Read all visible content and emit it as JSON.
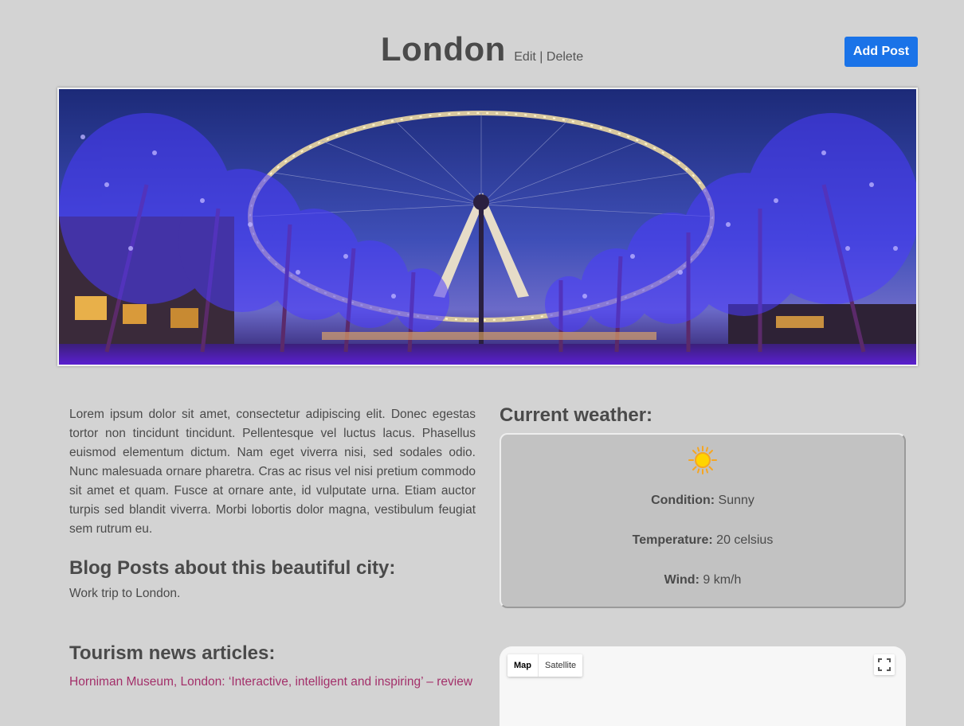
{
  "page": {
    "title": "London",
    "edit_label": "Edit",
    "separator": "|",
    "delete_label": "Delete",
    "add_post_label": "Add Post"
  },
  "description": "Lorem ipsum dolor sit amet, consectetur adipiscing elit. Donec egestas tortor non tincidunt tincidunt. Pellentesque vel luctus lacus. Phasellus euismod elementum dictum. Nam eget viverra nisi, sed sodales odio. Nunc malesuada ornare pharetra. Cras ac risus vel nisi pretium commodo sit amet et quam. Fusce at ornare ante, id vulputate urna. Etiam auctor turpis sed blandit viverra. Morbi lobortis dolor magna, vestibulum feugiat sem rutrum eu.",
  "blog": {
    "heading": "Blog Posts about this beautiful city:",
    "posts": [
      "Work trip to London."
    ]
  },
  "news": {
    "heading": "Tourism news articles:",
    "articles": [
      "Horniman Museum, London: ‘Interactive, intelligent and inspiring’ – review"
    ]
  },
  "weather": {
    "heading": "Current weather:",
    "icon": "sun-icon",
    "condition_label": "Condition:",
    "condition": "Sunny",
    "temperature_label": "Temperature:",
    "temperature": "20 celsius",
    "wind_label": "Wind:",
    "wind": "9 km/h"
  },
  "map": {
    "tabs": [
      "Map",
      "Satellite"
    ],
    "selected_tab": "Map"
  },
  "colors": {
    "background": "#d3d3d3",
    "button": "#1a73e8",
    "link": "#a3306a",
    "weather_box": "#c2c2c2"
  }
}
